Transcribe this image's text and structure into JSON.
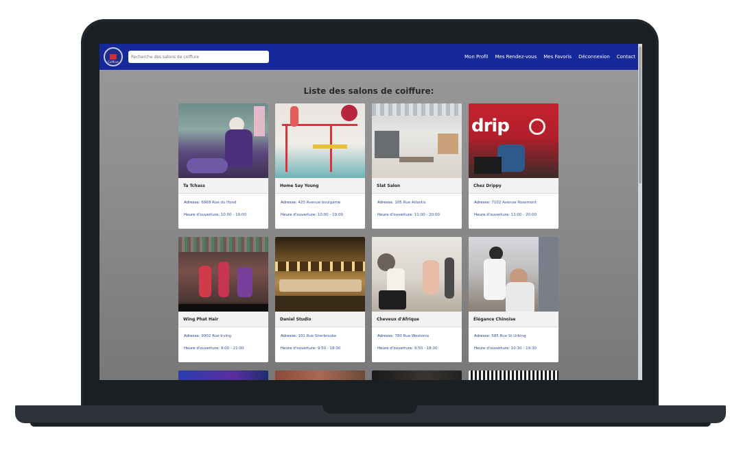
{
  "navbar": {
    "logo_text": "Coiffure",
    "search_placeholder": "Recherche des salons de coiffure",
    "links": [
      "Mon Profil",
      "Mes Rendez-vous",
      "Mes Favoris",
      "Déconnexion",
      "Contact"
    ]
  },
  "page": {
    "title": "Liste des salons de coiffure:"
  },
  "labels": {
    "address": "Adresse:",
    "hours": "Heure d'ouverture:"
  },
  "salons": [
    {
      "name": "Ta Tchass",
      "address": "6969 Rue du Hood",
      "hours": "10:00 - 19:00"
    },
    {
      "name": "Home Say Young",
      "address": "420 Avenue boulgame",
      "hours": "10:00 - 19:00"
    },
    {
      "name": "Slat Salon",
      "address": "105 Rue Atlantis",
      "hours": "11:00 - 20:00"
    },
    {
      "name": "Chez Drippy",
      "address": "7102 Avenue Rosemont",
      "hours": "11:00 - 20:00"
    },
    {
      "name": "Wing Phat Hair",
      "address": "9902 Rue Irving",
      "hours": "9:00 - 21:00"
    },
    {
      "name": "Daniel Studio",
      "address": "101 Rue Sherbrooke",
      "hours": "9:50 - 18:30"
    },
    {
      "name": "Cheveux d'Afrique",
      "address": "780 Rue Westonia",
      "hours": "9:50 - 18:30"
    },
    {
      "name": "Élégance Chinoise",
      "address": "585 Rue St Urbing",
      "hours": "10:30 - 19:30"
    }
  ],
  "colors": {
    "navbar": "#16299a",
    "card_text": "#2b4fa8",
    "background_top": "#9a9a9a",
    "background_bottom": "#787878"
  }
}
